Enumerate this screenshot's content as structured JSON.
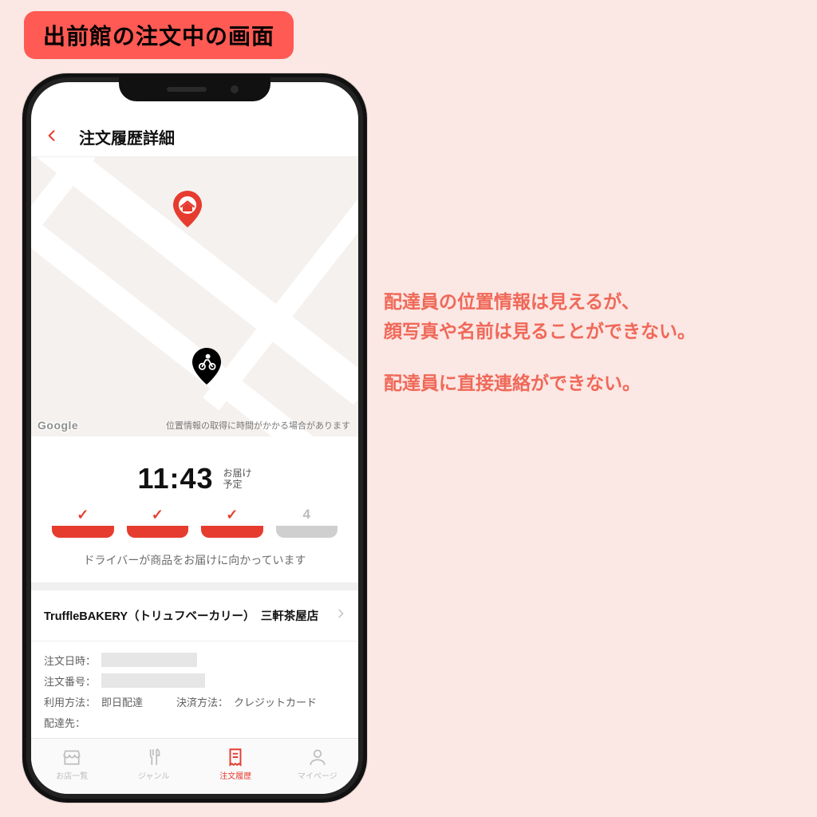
{
  "title_chip": "出前館の注文中の画面",
  "side": {
    "p1": "配達員の位置情報は見えるが、",
    "p2": "顔写真や名前は見ることができない。",
    "p3": "配達員に直接連絡ができない。"
  },
  "header": {
    "title": "注文履歴詳細"
  },
  "map": {
    "google_label": "Google",
    "notice": "位置情報の取得に時間がかかる場合があります"
  },
  "status": {
    "eta_time": "11:43",
    "eta_label_l1": "お届け",
    "eta_label_l2": "予定",
    "step4_num": "4",
    "message": "ドライバーが商品をお届けに向かっています"
  },
  "store": {
    "name": "TruffleBAKERY（トリュフベーカリー）　三軒茶屋店"
  },
  "details": {
    "order_date_label": "注文日時：",
    "order_no_label": "注文番号：",
    "usage_label": "利用方法：",
    "usage_value": "即日配達",
    "payment_label": "決済方法：",
    "payment_value": "クレジットカード",
    "delivery_to_label": "配達先："
  },
  "tabs": {
    "t1": "お店一覧",
    "t2": "ジャンル",
    "t3": "注文履歴",
    "t4": "マイページ"
  },
  "colors": {
    "accent": "#e63c2f"
  }
}
